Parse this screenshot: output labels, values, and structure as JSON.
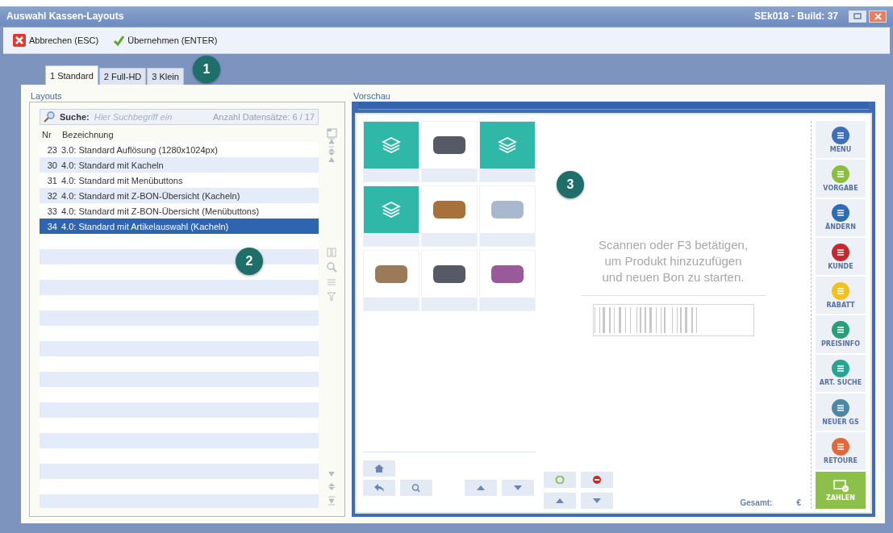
{
  "window": {
    "title": "Auswahl Kassen-Layouts",
    "build": "SEk018 - Build: 37"
  },
  "toolbar": [
    {
      "kind": "cancel",
      "label": "Abbrechen (ESC)"
    },
    {
      "kind": "accept",
      "label": "Übernehmen (ENTER)"
    }
  ],
  "tabs": [
    {
      "label": "1 Standard",
      "selected": true
    },
    {
      "label": "2 Full-HD",
      "selected": false
    },
    {
      "label": "3 Klein",
      "selected": false
    }
  ],
  "callouts": [
    "1",
    "2",
    "3"
  ],
  "layouts": {
    "title": "Layouts",
    "search_label": "Suche:",
    "search_placeholder": "Hier Suchbegriff ein",
    "record_count": "Anzahl Datensätze: 6 / 17",
    "columns": [
      "Nr",
      "Bezeichnung"
    ],
    "rows": [
      {
        "nr": "23",
        "name": "3.0: Standard Auflösung (1280x1024px)",
        "selected": false
      },
      {
        "nr": "30",
        "name": "4.0: Standard mit Kacheln",
        "selected": false
      },
      {
        "nr": "31",
        "name": "4.0: Standard mit Menübuttons",
        "selected": false
      },
      {
        "nr": "32",
        "name": "4.0: Standard mit Z-BON-Übersicht (Kacheln)",
        "selected": false
      },
      {
        "nr": "33",
        "name": "4.0: Standard mit Z-BON-Übersicht (Menübuttons)",
        "selected": false
      },
      {
        "nr": "34",
        "name": "4.0: Standard mit Artikelauswahl (Kacheln)",
        "selected": true
      }
    ]
  },
  "preview": {
    "title": "Vorschau",
    "scan_hint": "Scannen oder F3 betätigen,\num Produkt hinzuzufügen\nund neuen Bon zu starten.",
    "tiles": [
      {
        "kind": "category"
      },
      {
        "kind": "photo"
      },
      {
        "kind": "category"
      },
      {
        "kind": "category"
      },
      {
        "kind": "photo"
      },
      {
        "kind": "photo"
      },
      {
        "kind": "photo"
      },
      {
        "kind": "photo"
      },
      {
        "kind": "photo"
      }
    ],
    "side_buttons": [
      {
        "kind": "round",
        "label": "MENU",
        "color": "#3f6fb6"
      },
      {
        "kind": "round",
        "label": "VORGABE",
        "color": "#8bbd3e"
      },
      {
        "kind": "round",
        "label": "ÄNDERN",
        "color": "#2e6cb4"
      },
      {
        "kind": "round",
        "label": "KUNDE",
        "color": "#c22a30"
      },
      {
        "kind": "round",
        "label": "RABATT",
        "color": "#f1c31a"
      },
      {
        "kind": "round",
        "label": "PREISINFO",
        "color": "#27a07a"
      },
      {
        "kind": "round",
        "label": "ART. SUCHE",
        "color": "#27a593"
      },
      {
        "kind": "round",
        "label": "NEUER GS",
        "color": "#4f86a8"
      },
      {
        "kind": "round",
        "label": "RETOURE",
        "color": "#e0683a"
      },
      {
        "kind": "pay",
        "label": "ZAHLEN",
        "color": "#8cc04a"
      }
    ],
    "total_label": "Gesamt:",
    "currency": "€"
  }
}
